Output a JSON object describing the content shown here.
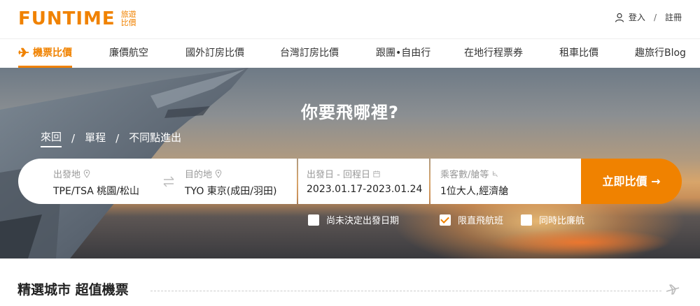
{
  "brand": {
    "name": "FUNTIME",
    "sub1": "旅遊",
    "sub2": "比價",
    "accent": "#f08200"
  },
  "auth": {
    "login": "登入",
    "separator": "/",
    "register": "註冊"
  },
  "nav": [
    {
      "label": "機票比價",
      "active": true
    },
    {
      "label": "廉價航空"
    },
    {
      "label": "國外訂房比價"
    },
    {
      "label": "台灣訂房比價"
    },
    {
      "label": "跟團•自由行"
    },
    {
      "label": "在地行程票券"
    },
    {
      "label": "租車比價"
    },
    {
      "label": "趣旅行Blog"
    }
  ],
  "hero": {
    "title": "你要飛哪裡?"
  },
  "trip_tabs": [
    {
      "label": "來回",
      "active": true
    },
    {
      "label": "單程"
    },
    {
      "label": "不同點進出"
    }
  ],
  "trip_separator": "/",
  "search": {
    "from": {
      "label": "出發地",
      "value": "TPE/TSA 桃園/松山"
    },
    "to": {
      "label": "目的地",
      "value": "TYO 東京(成田/羽田)"
    },
    "dates": {
      "label": "出發日 - 回程日",
      "value": "2023.01.17-2023.01.24"
    },
    "pax": {
      "label": "乘客數/艙等",
      "value": "1位大人,經濟艙"
    },
    "submit": "立即比價 →"
  },
  "options": [
    {
      "label": "尚未決定出發日期",
      "checked": false
    },
    {
      "label": "限直飛航班",
      "checked": true
    },
    {
      "label": "同時比廉航",
      "checked": false
    }
  ],
  "section": {
    "title": "精選城市 超值機票"
  }
}
